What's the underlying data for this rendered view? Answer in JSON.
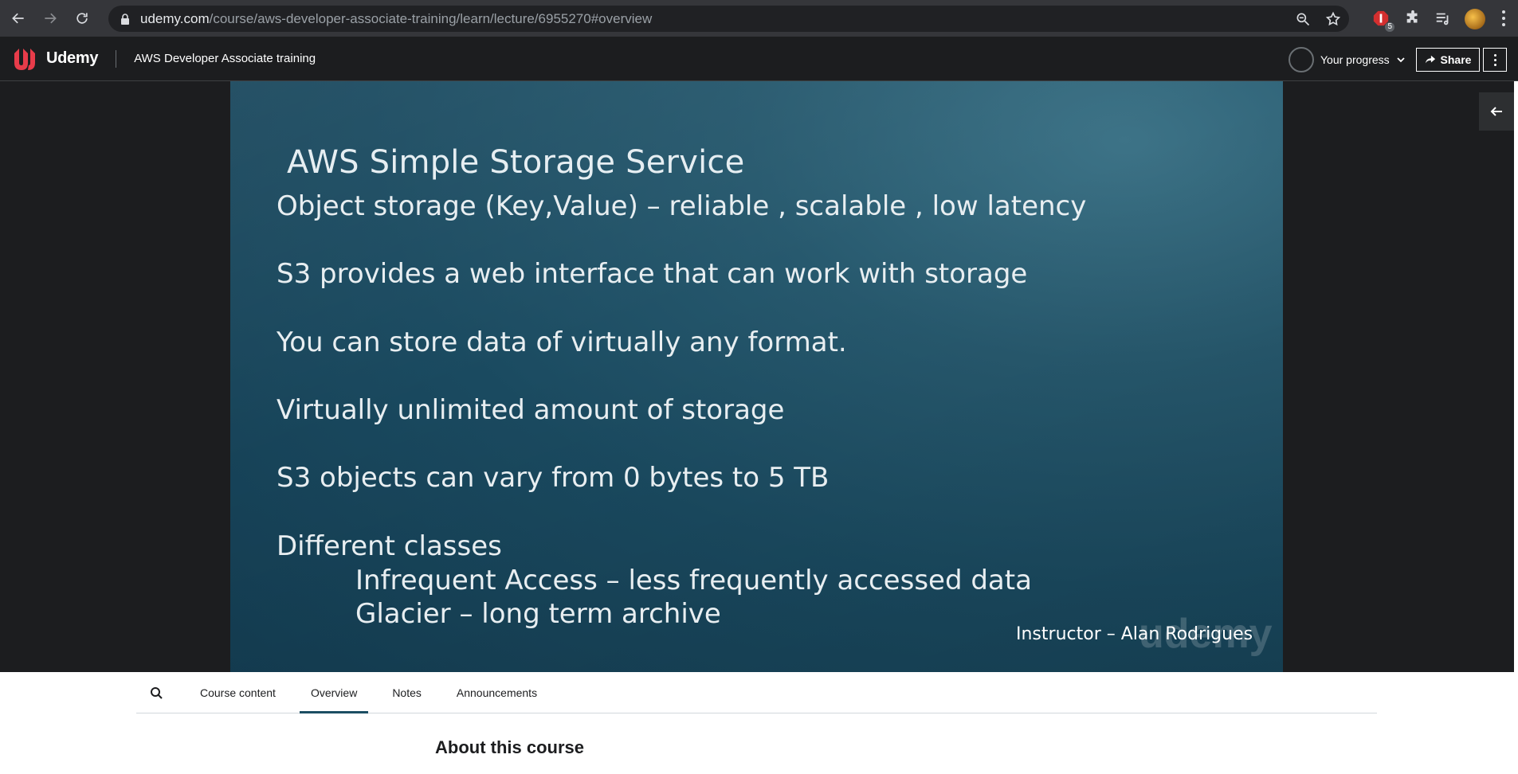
{
  "browser": {
    "url_host": "udemy.com",
    "url_path": "/course/aws-developer-associate-training/learn/lecture/6955270#overview",
    "extension_badge": "5"
  },
  "header": {
    "logo_text": "Udemy",
    "course_title": "AWS Developer Associate training",
    "progress_label": "Your progress",
    "share_label": "Share"
  },
  "video": {
    "slide": {
      "title": "AWS Simple Storage Service",
      "bullets": [
        "Object storage (Key,Value) – reliable , scalable , low latency",
        "S3 provides a web interface that can work with storage",
        "You can store data of virtually any format.",
        "Virtually unlimited amount of storage",
        "S3 objects can vary from 0 bytes to 5 TB",
        "Different classes"
      ],
      "sub_bullets": [
        "Infrequent Access – less frequently accessed data",
        "Glacier – long term archive"
      ],
      "instructor": "Instructor – Alan Rodrigues",
      "watermark": "udemy"
    }
  },
  "tabs": {
    "items": [
      {
        "label": "Course content"
      },
      {
        "label": "Overview"
      },
      {
        "label": "Notes"
      },
      {
        "label": "Announcements"
      }
    ],
    "active_index": 1
  },
  "overview": {
    "heading": "About this course"
  },
  "colors": {
    "brand_red": "#a435f0",
    "header_bg": "#1c1d1f",
    "active_tab_underline": "#1c4e63"
  }
}
